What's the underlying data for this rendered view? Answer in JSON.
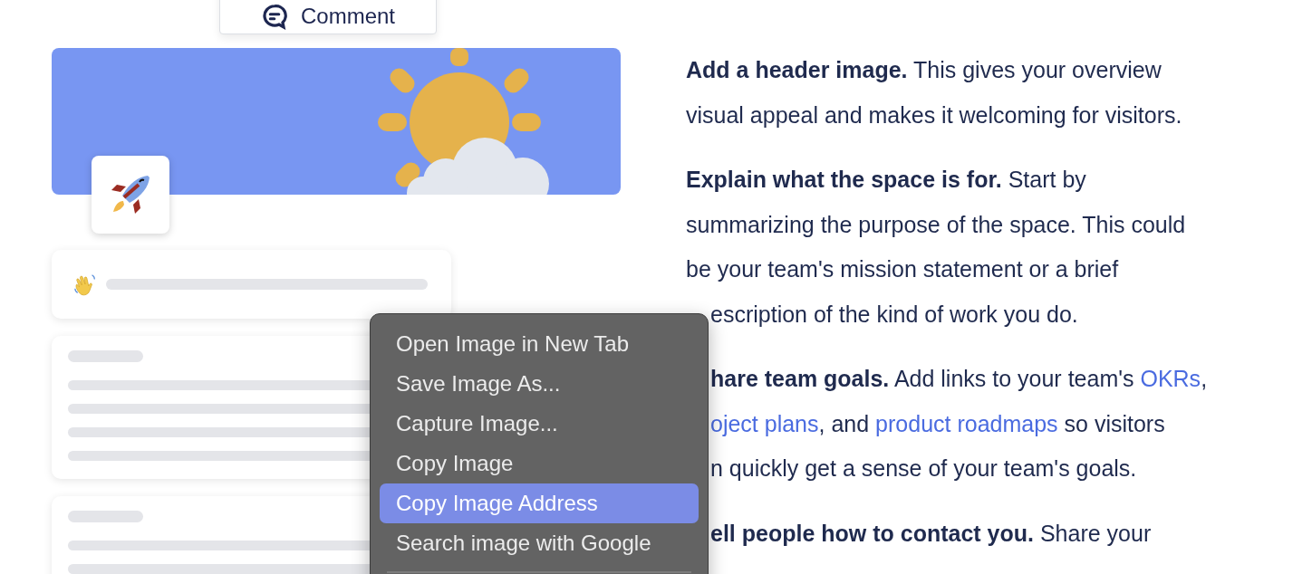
{
  "comment_button": {
    "label": "Comment"
  },
  "preview_cards": [
    {
      "kind": "greeting"
    },
    {
      "kind": "skeleton"
    },
    {
      "kind": "skeleton_partial"
    }
  ],
  "paragraphs": [
    {
      "lines": [
        [
          {
            "kind": "bold",
            "text": "Add a header image."
          },
          {
            "kind": "plain",
            "text": " This gives your overview"
          }
        ],
        [
          {
            "kind": "plain",
            "text": "visual appeal and makes it welcoming for visitors."
          }
        ]
      ]
    },
    {
      "lines": [
        [
          {
            "kind": "bold",
            "text": "Explain what the space is for."
          },
          {
            "kind": "plain",
            "text": " Start by"
          }
        ],
        [
          {
            "kind": "plain",
            "text": "summarizing the purpose of the space. This could"
          }
        ],
        [
          {
            "kind": "plain",
            "text": "be your team's mission statement or a brief"
          }
        ],
        [
          {
            "kind": "plain",
            "text": "escription of the kind of work you do."
          }
        ]
      ]
    },
    {
      "lines": [
        [
          {
            "kind": "bold",
            "text": "hare team goals."
          },
          {
            "kind": "plain",
            "text": " Add links to your team's "
          },
          {
            "kind": "link",
            "text": "OKRs"
          },
          {
            "kind": "plain",
            "text": ","
          }
        ],
        [
          {
            "kind": "link",
            "text": "oject plans"
          },
          {
            "kind": "plain",
            "text": ", and "
          },
          {
            "kind": "link",
            "text": "product roadmaps"
          },
          {
            "kind": "plain",
            "text": " so visitors"
          }
        ],
        [
          {
            "kind": "plain",
            "text": "n quickly get a sense of your team's goals."
          }
        ]
      ]
    },
    {
      "lines": [
        [
          {
            "kind": "bold",
            "text": "ell people how to contact you."
          },
          {
            "kind": "plain",
            "text": " Share your"
          }
        ]
      ]
    }
  ],
  "context_menu": {
    "items": [
      {
        "label": "Open Image in New Tab",
        "selected": false
      },
      {
        "label": "Save Image As...",
        "selected": false
      },
      {
        "label": "Capture Image...",
        "selected": false
      },
      {
        "label": "Copy Image",
        "selected": false
      },
      {
        "label": "Copy Image Address",
        "selected": true
      },
      {
        "label": "Search image with Google",
        "selected": false
      }
    ]
  }
}
